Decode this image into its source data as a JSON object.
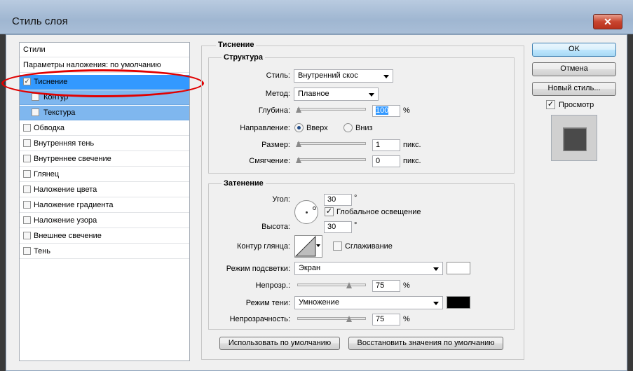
{
  "window": {
    "title": "Стиль слоя",
    "close_glyph": "✕"
  },
  "styles_panel": {
    "header": "Стили",
    "blend_options": "Параметры наложения: по умолчанию",
    "items": [
      {
        "label": "Тиснение",
        "checked": true,
        "check_glyph": "✓"
      },
      {
        "label": "Контур",
        "checked": false
      },
      {
        "label": "Текстура",
        "checked": false
      },
      {
        "label": "Обводка",
        "checked": false
      },
      {
        "label": "Внутренняя тень",
        "checked": false
      },
      {
        "label": "Внутреннее свечение",
        "checked": false
      },
      {
        "label": "Глянец",
        "checked": false
      },
      {
        "label": "Наложение цвета",
        "checked": false
      },
      {
        "label": "Наложение градиента",
        "checked": false
      },
      {
        "label": "Наложение узора",
        "checked": false
      },
      {
        "label": "Внешнее свечение",
        "checked": false
      },
      {
        "label": "Тень",
        "checked": false
      }
    ]
  },
  "bevel": {
    "section_title": "Тиснение",
    "structure": {
      "title": "Структура",
      "style_label": "Стиль:",
      "style_value": "Внутренний скос",
      "technique_label": "Метод:",
      "technique_value": "Плавное",
      "depth_label": "Глубина:",
      "depth_value": "100",
      "depth_unit": "%",
      "depth_level": 0.02,
      "direction_label": "Направление:",
      "direction_up": "Вверх",
      "direction_down": "Вниз",
      "direction_selected": "up",
      "size_label": "Размер:",
      "size_value": "1",
      "size_unit": "пикс.",
      "soften_label": "Смягчение:",
      "soften_value": "0",
      "soften_unit": "пикс."
    },
    "shading": {
      "title": "Затенение",
      "angle_label": "Угол:",
      "angle_value": "30",
      "degree": "°",
      "global_light_label": "Глобальное освещение",
      "global_light_checked": true,
      "altitude_label": "Высота:",
      "altitude_value": "30",
      "gloss_label": "Контур глянца:",
      "antialias_label": "Сглаживание",
      "highlight_mode_label": "Режим подсветки:",
      "highlight_mode_value": "Экран",
      "highlight_color": "#ffffff",
      "highlight_opacity_label": "Непрозр.:",
      "highlight_opacity_value": "75",
      "highlight_opacity_unit": "%",
      "highlight_opacity_level": 0.75,
      "shadow_mode_label": "Режим тени:",
      "shadow_mode_value": "Умножение",
      "shadow_color": "#000000",
      "shadow_opacity_label": "Непрозрачность:",
      "shadow_opacity_value": "75",
      "shadow_opacity_unit": "%",
      "shadow_opacity_level": 0.75
    },
    "make_default": "Использовать по умолчанию",
    "reset_default": "Восстановить значения по умолчанию"
  },
  "right": {
    "ok": "OK",
    "cancel": "Отмена",
    "new_style": "Новый стиль...",
    "preview_label": "Просмотр",
    "preview_checked": true,
    "check_glyph": "✓"
  },
  "colors": {
    "selection": "#3399ff",
    "highlight_ring": "#e00000"
  }
}
